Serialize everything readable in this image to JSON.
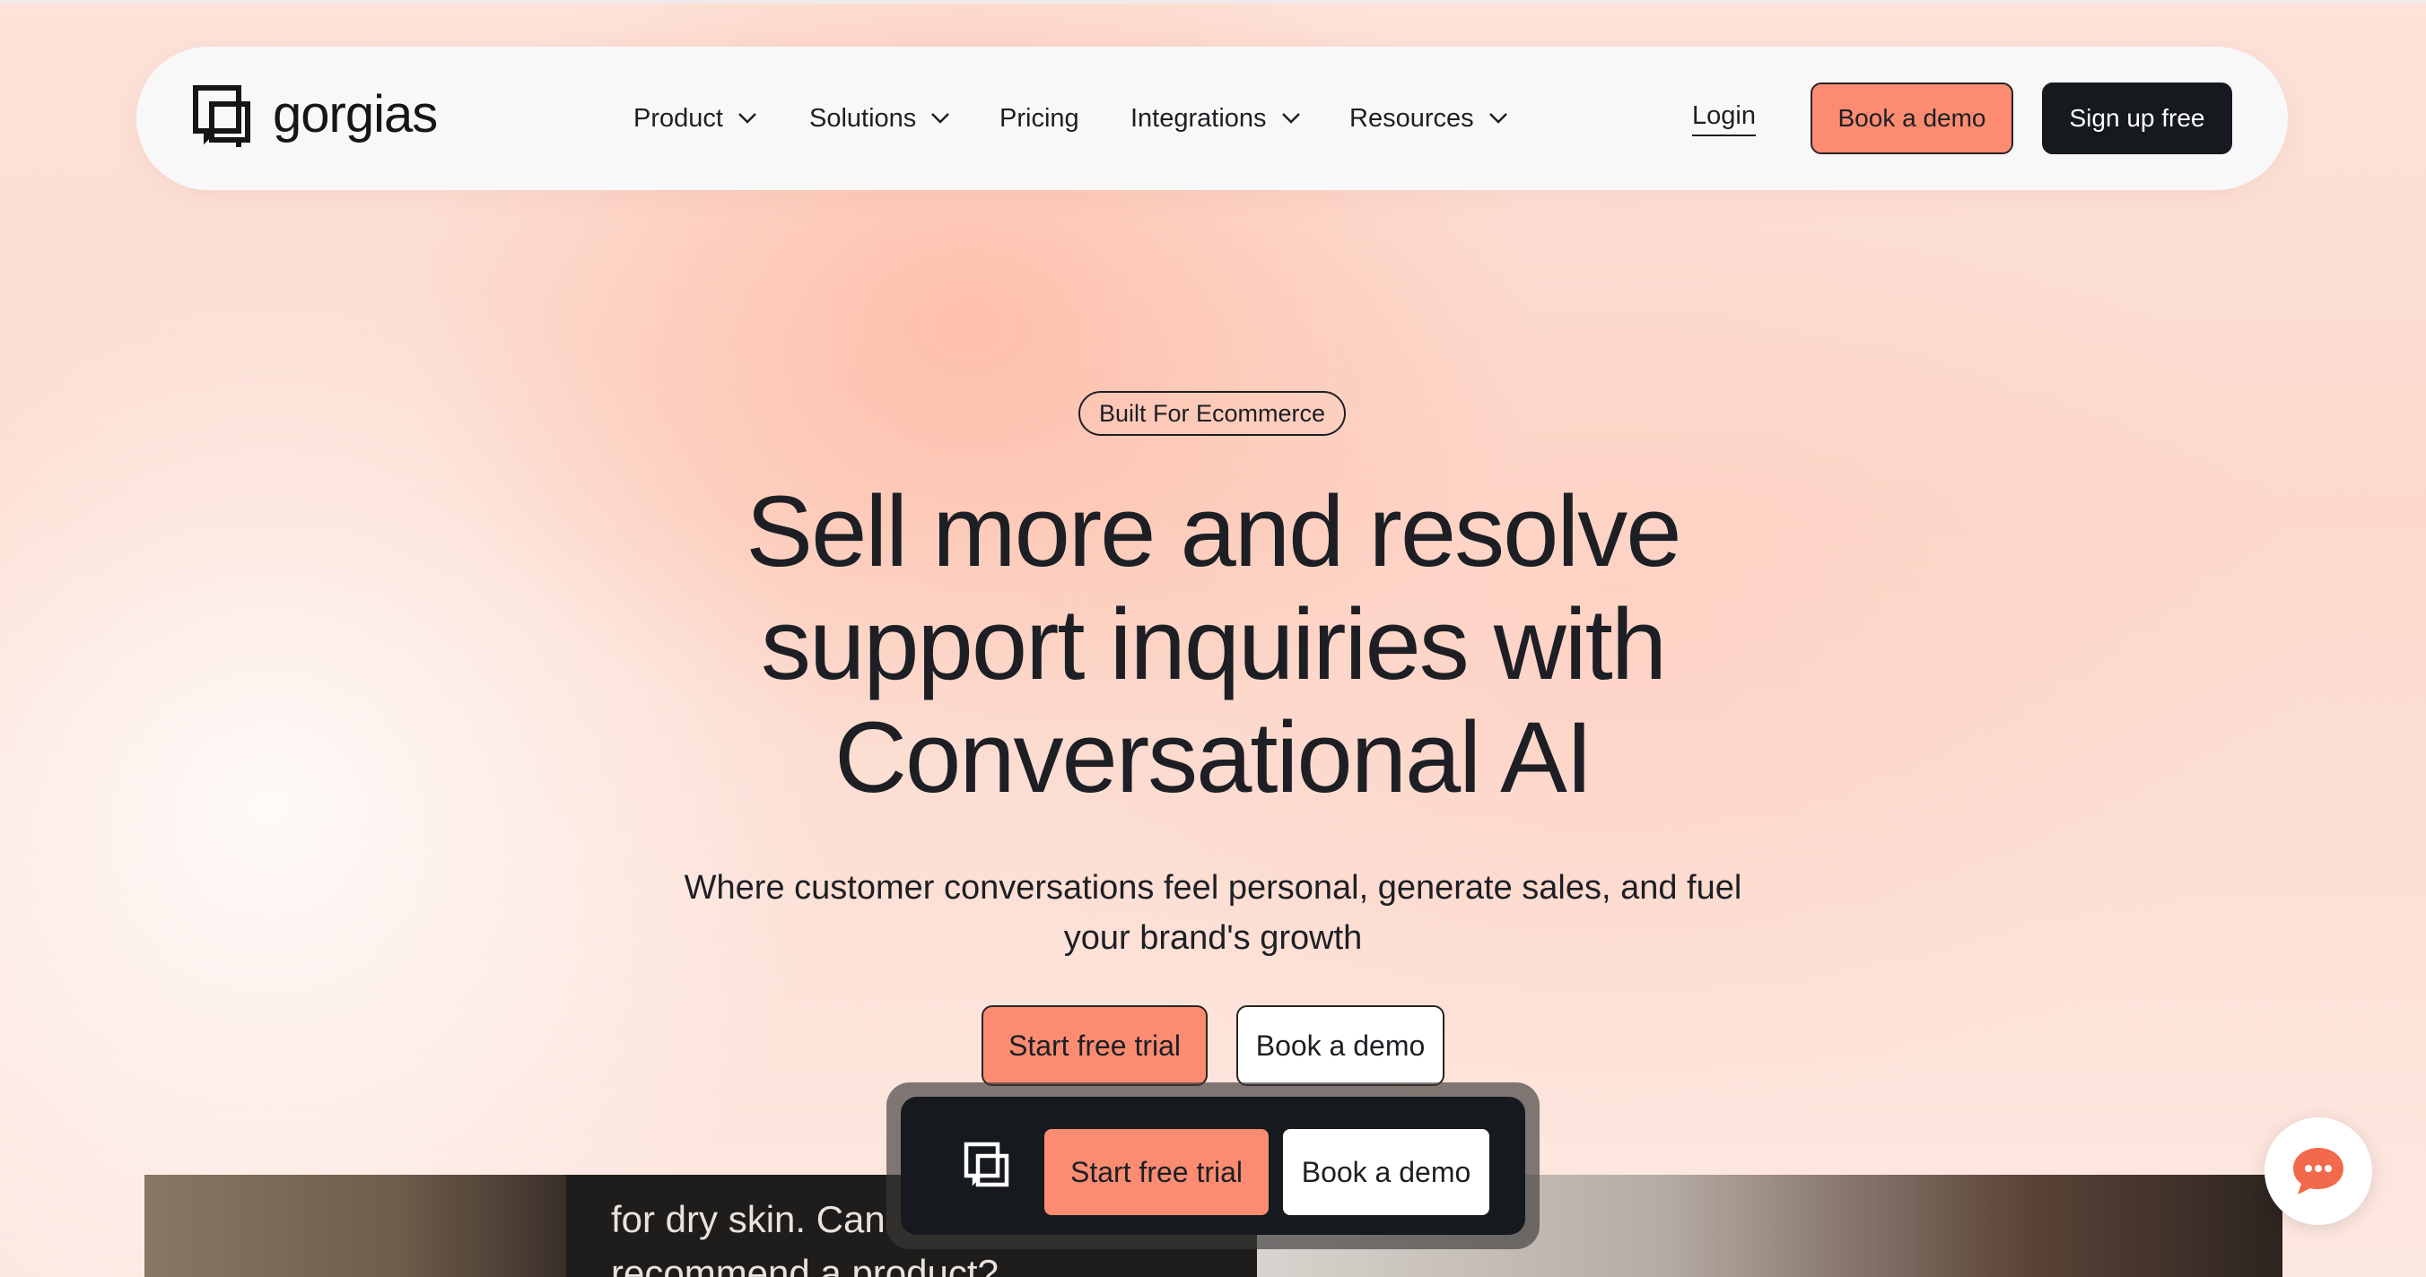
{
  "nav": {
    "logo_text": "gorgias",
    "items": [
      {
        "label": "Product",
        "has_dropdown": true
      },
      {
        "label": "Solutions",
        "has_dropdown": true
      },
      {
        "label": "Pricing",
        "has_dropdown": false
      },
      {
        "label": "Integrations",
        "has_dropdown": true
      },
      {
        "label": "Resources",
        "has_dropdown": true
      }
    ],
    "login_label": "Login",
    "book_demo_label": "Book a demo",
    "signup_label": "Sign up free"
  },
  "hero": {
    "badge": "Built For Ecommerce",
    "headline_lines": [
      "Sell more and resolve",
      "support inquiries with",
      "Conversational AI"
    ],
    "subhead_lines": [
      "Where customer conversations feel personal, generate sales, and fuel",
      "your brand's growth"
    ],
    "primary_cta": "Start free trial",
    "secondary_cta": "Book a demo"
  },
  "media": {
    "chat_bubble_lines": [
      "for dry skin. Can",
      "recommend a product?"
    ]
  },
  "sticky_bar": {
    "primary_cta": "Start free trial",
    "secondary_cta": "Book a demo"
  },
  "colors": {
    "accent": "#fb8c72",
    "dark": "#16191e",
    "text": "#1d1f24"
  },
  "icons": {
    "logo": "gorgias-logo-icon",
    "dropdown": "chevron-down-icon",
    "chat": "chat-bubble-icon"
  }
}
